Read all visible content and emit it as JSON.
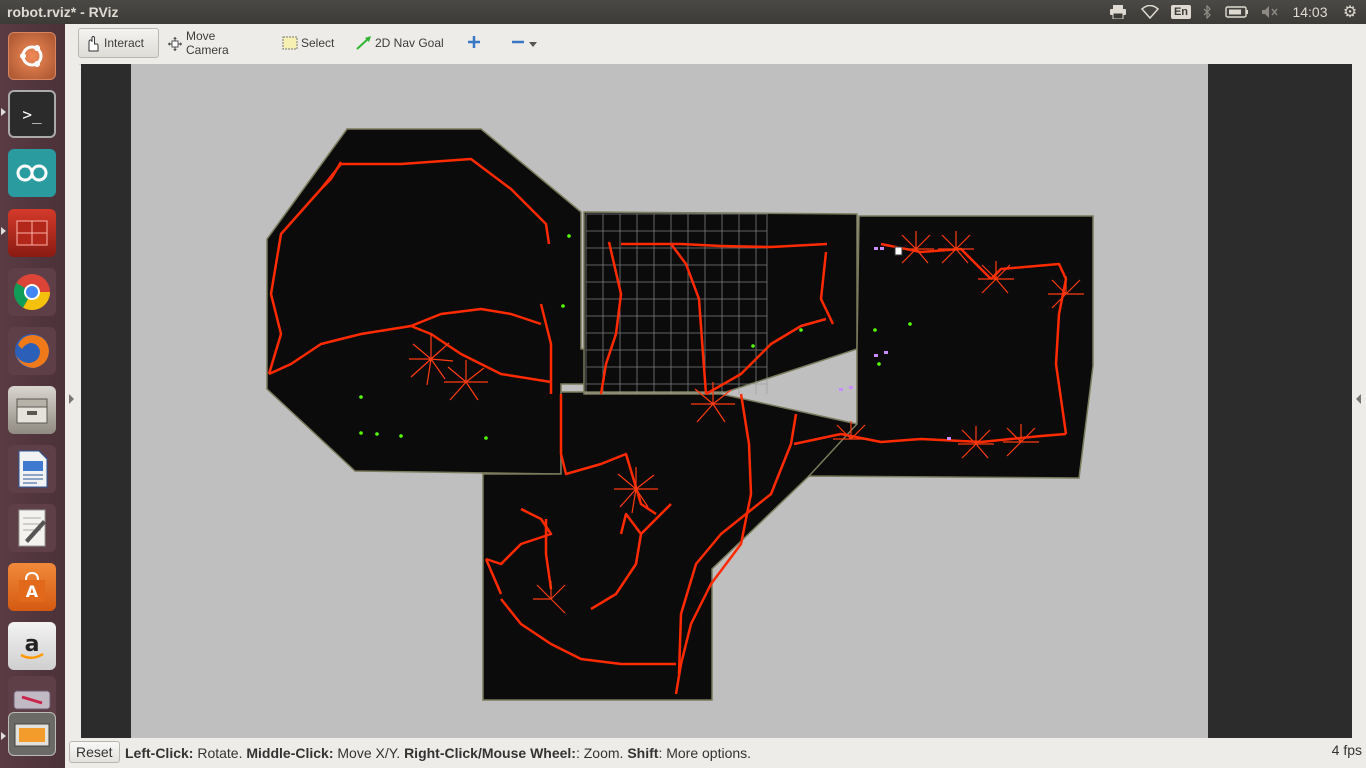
{
  "window": {
    "title": "robot.rviz* - RViz"
  },
  "topbar": {
    "lang": "En",
    "clock": "14:03"
  },
  "launcher": {
    "items": [
      {
        "name": "ubuntu-dash-icon"
      },
      {
        "name": "terminal-icon"
      },
      {
        "name": "arduino-icon"
      },
      {
        "name": "red-app-icon"
      },
      {
        "name": "chrome-icon"
      },
      {
        "name": "firefox-icon"
      },
      {
        "name": "files-icon"
      },
      {
        "name": "writer-icon"
      },
      {
        "name": "text-editor-icon"
      },
      {
        "name": "software-center-icon"
      },
      {
        "name": "amazon-icon"
      },
      {
        "name": "startup-disk-icon"
      },
      {
        "name": "screenshot-icon"
      }
    ]
  },
  "toolbar": {
    "interact": "Interact",
    "move_camera": "Move Camera",
    "select": "Select",
    "nav_goal": "2D Nav Goal"
  },
  "status": {
    "reset": "Reset",
    "left_click": "Left-Click:",
    "left_click_desc": " Rotate. ",
    "middle_click": "Middle-Click:",
    "middle_click_desc": " Move X/Y. ",
    "right_click": "Right-Click/Mouse Wheel:",
    "right_click_desc": ": Zoom. ",
    "shift": "Shift",
    "shift_desc": ": More options.",
    "fps": "4 fps"
  },
  "colors": {
    "map_free": "#0b0b0b",
    "map_unknown": "#bfbfbf",
    "path": "#ff2a00",
    "pose_arrow": "#55ff00",
    "grid": "#9a9a9a"
  }
}
